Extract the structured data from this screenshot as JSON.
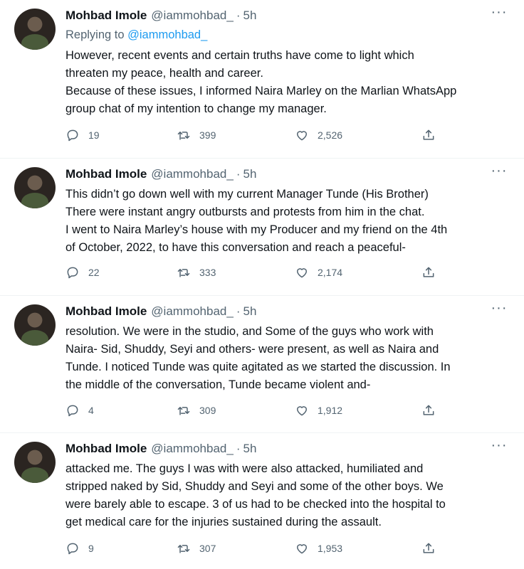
{
  "tweets": [
    {
      "name": "Mohbad Imole",
      "handle": "@iammohbad_",
      "dot": "·",
      "time": "5h",
      "replying_prefix": "Replying to ",
      "replying_to": "@iammohbad_",
      "lines": [
        "However, recent events and certain truths have come to light which",
        "threaten my peace,  health and career.",
        "Because of these issues, I informed Naira Marley on the Marlian WhatsApp",
        "group chat of my intention to change my manager."
      ],
      "replies": "19",
      "retweets": "399",
      "likes": "2,526"
    },
    {
      "name": "Mohbad Imole",
      "handle": "@iammohbad_",
      "dot": "·",
      "time": "5h",
      "lines": [
        "This didn’t go down well with my current Manager Tunde (His Brother)",
        "There were instant angry outbursts and protests from him in the chat.",
        "I went to Naira Marley’s house with my Producer and my friend on the 4th",
        "of October, 2022, to have this conversation and reach a peaceful-"
      ],
      "replies": "22",
      "retweets": "333",
      "likes": "2,174"
    },
    {
      "name": "Mohbad Imole",
      "handle": "@iammohbad_",
      "dot": "·",
      "time": "5h",
      "lines": [
        "resolution. We were in the studio, and Some of the guys who work with",
        "Naira- Sid, Shuddy, Seyi and others- were present, as well as Naira and",
        "Tunde. I noticed Tunde was quite agitated as we started the discussion.  In",
        "the middle of the conversation, Tunde became violent and-"
      ],
      "replies": "4",
      "retweets": "309",
      "likes": "1,912"
    },
    {
      "name": "Mohbad Imole",
      "handle": "@iammohbad_",
      "dot": "·",
      "time": "5h",
      "lines": [
        "attacked me. The guys I was with were also attacked, humiliated and",
        "stripped naked by Sid, Shuddy and Seyi and some of the other boys. We",
        "were barely able to escape. 3 of us had to be checked into the hospital to",
        "get medical care for the injuries sustained during the assault."
      ],
      "replies": "9",
      "retweets": "307",
      "likes": "1,953"
    }
  ],
  "colors": {
    "text": "#0f1419",
    "secondary": "#536471",
    "link": "#1d9bf0"
  },
  "icons": [
    "reply-icon",
    "retweet-icon",
    "like-icon",
    "share-icon",
    "more-icon",
    "avatar"
  ]
}
